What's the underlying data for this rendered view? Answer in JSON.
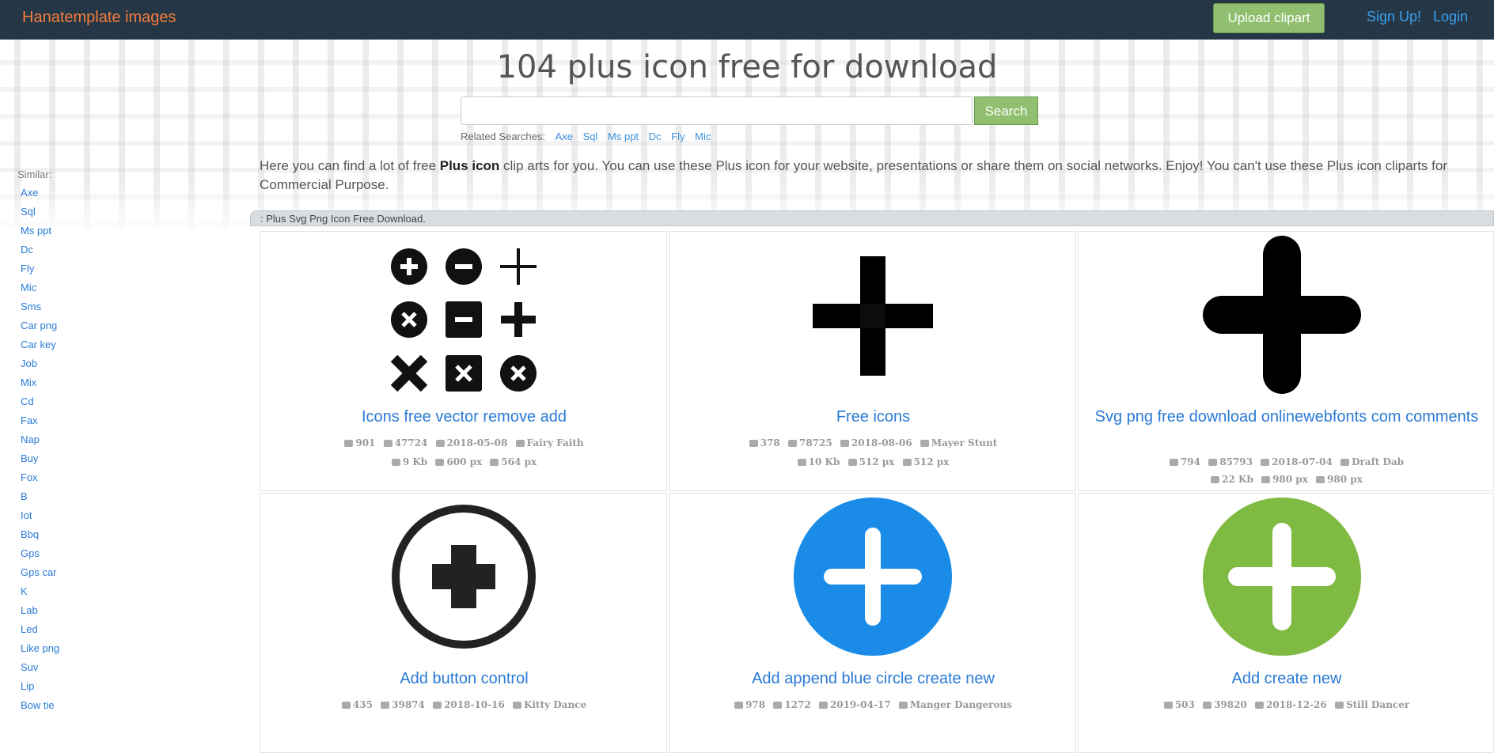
{
  "nav": {
    "brand": "Hanatemplate images",
    "upload_label": "Upload clipart",
    "signup_label": "Sign Up!",
    "login_label": "Login"
  },
  "page_title": "104 plus icon free for download",
  "search": {
    "placeholder": "",
    "button_label": "Search"
  },
  "related": {
    "label": "Related Searches:",
    "items": [
      "Axe",
      "Sql",
      "Ms ppt",
      "Dc",
      "Fly",
      "Mic"
    ]
  },
  "sidebar": {
    "title": "Similar:",
    "items": [
      "Axe",
      "Sql",
      "Ms ppt",
      "Dc",
      "Fly",
      "Mic",
      "Sms",
      "Car png",
      "Car key",
      "Job",
      "Mix",
      "Cd",
      "Fax",
      "Nap",
      "Buy",
      "Fox",
      "B",
      "Iot",
      "Bbq",
      "Gps",
      "Gps car",
      "K",
      "Lab",
      "Led",
      "Like png",
      "Suv",
      "Lip",
      "Bow tie"
    ]
  },
  "intro": {
    "part1": "Here you can find a lot of free ",
    "bold": "Plus icon",
    "part2": " clip arts for you. You can use these Plus icon for your website, presentations or share them on social networks. Enjoy! You can't use these Plus icon cliparts for Commercial Purpose."
  },
  "section_label": ": Plus Svg Png Icon Free Download.",
  "cards": [
    {
      "title": "Icons free vector remove add",
      "downloads": "901",
      "views": "47724",
      "date": "2018-05-08",
      "author": "Fairy Faith",
      "size": "9 Kb",
      "width": "600 px",
      "height": "564 px",
      "icon": "plus-minus-set-icon"
    },
    {
      "title": "Free icons",
      "downloads": "378",
      "views": "78725",
      "date": "2018-08-06",
      "author": "Mayer Stunt",
      "size": "10 Kb",
      "width": "512 px",
      "height": "512 px",
      "icon": "plus-square-icon"
    },
    {
      "title": "Svg png free download onlinewebfonts com comments",
      "downloads": "794",
      "views": "85793",
      "date": "2018-07-04",
      "author": "Draft Dab",
      "size": "22 Kb",
      "width": "980 px",
      "height": "980 px",
      "icon": "plus-rounded-icon"
    },
    {
      "title": "Add button control",
      "downloads": "435",
      "views": "39874",
      "date": "2018-10-16",
      "author": "Kitty Dance",
      "icon": "plus-circle-outline-icon"
    },
    {
      "title": "Add append blue circle create new",
      "downloads": "978",
      "views": "1272",
      "date": "2019-04-17",
      "author": "Manger Dangerous",
      "icon": "plus-blue-circle-icon"
    },
    {
      "title": "Add create new",
      "downloads": "503",
      "views": "39820",
      "date": "2018-12-26",
      "author": "Still Dancer",
      "icon": "plus-green-circle-icon"
    }
  ],
  "colors": {
    "navbar": "#253746",
    "brand": "#f47c3c",
    "accent_green": "#8fbf6f",
    "link": "#2a7ad6",
    "blue_icon": "#1a8ce8",
    "green_icon": "#7fbb42"
  }
}
